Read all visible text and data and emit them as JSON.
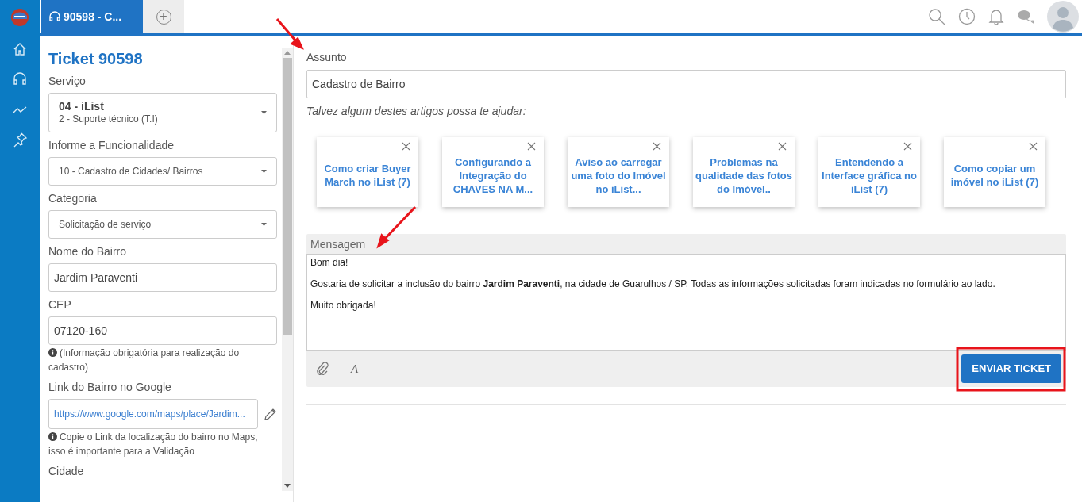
{
  "tabs": [
    {
      "label": "90598 - C...",
      "selected": true,
      "kind": "ticket"
    },
    {
      "label": "+",
      "selected": false,
      "kind": "add"
    }
  ],
  "sidebar": {
    "items": [
      {
        "kind": "home",
        "selected": false
      },
      {
        "kind": "support",
        "selected": false
      },
      {
        "kind": "chart",
        "selected": false
      },
      {
        "kind": "pin",
        "selected": false
      }
    ]
  },
  "ticket_panel": {
    "title": "Ticket 90598",
    "fields": [
      {
        "kind": "select2",
        "label": "Serviço",
        "value": "04 - iList",
        "subvalue": "2 - Suporte técnico (T.I)"
      },
      {
        "kind": "select",
        "label": "Informe a Funcionalidade",
        "value": "10 - Cadastro de Cidades/ Bairros"
      },
      {
        "kind": "select",
        "label": "Categoria",
        "value": "Solicitação de serviço"
      },
      {
        "kind": "text",
        "label": "Nome do Bairro",
        "value": "Jardim Paraventi"
      },
      {
        "kind": "text",
        "label": "CEP",
        "value": "07120-160",
        "hint": "(Informação obrigatória para realização do cadastro)"
      },
      {
        "kind": "link",
        "label": "Link do Bairro no Google",
        "value": "https://www.google.com/maps/place/Jardim...",
        "hint": "Copie o Link da localização do bairro no Maps, isso é importante para a Validação"
      },
      {
        "kind": "label",
        "label": "Cidade"
      }
    ]
  },
  "subject": {
    "label": "Assunto",
    "value": "Cadastro de Bairro"
  },
  "suggestions": {
    "label": "Talvez algum destes artigos possa te ajudar:",
    "articles": [
      {
        "title": "Como criar Buyer March no iList (7)"
      },
      {
        "title": "Configurando a Integração do CHAVES NA M..."
      },
      {
        "title": "Aviso ao carregar uma foto do Imóvel no iList..."
      },
      {
        "title": "Problemas na qualidade das fotos do Imóvel.."
      },
      {
        "title": "Entendendo a Interface gráfica no iList (7)"
      },
      {
        "title": "Como copiar um imóvel no iList (7)"
      }
    ]
  },
  "message": {
    "label": "Mensagem",
    "paragraphs": [
      "Bom dia!",
      "Gostaria de solicitar a inclusão do bairro **Jardim Paraventi**, na cidade de Guarulhos / SP. Todas as informações solicitadas foram indicadas no formulário ao lado.",
      "Muito obrigada!"
    ],
    "format_button": "A",
    "submit": "ENVIAR TICKET"
  }
}
